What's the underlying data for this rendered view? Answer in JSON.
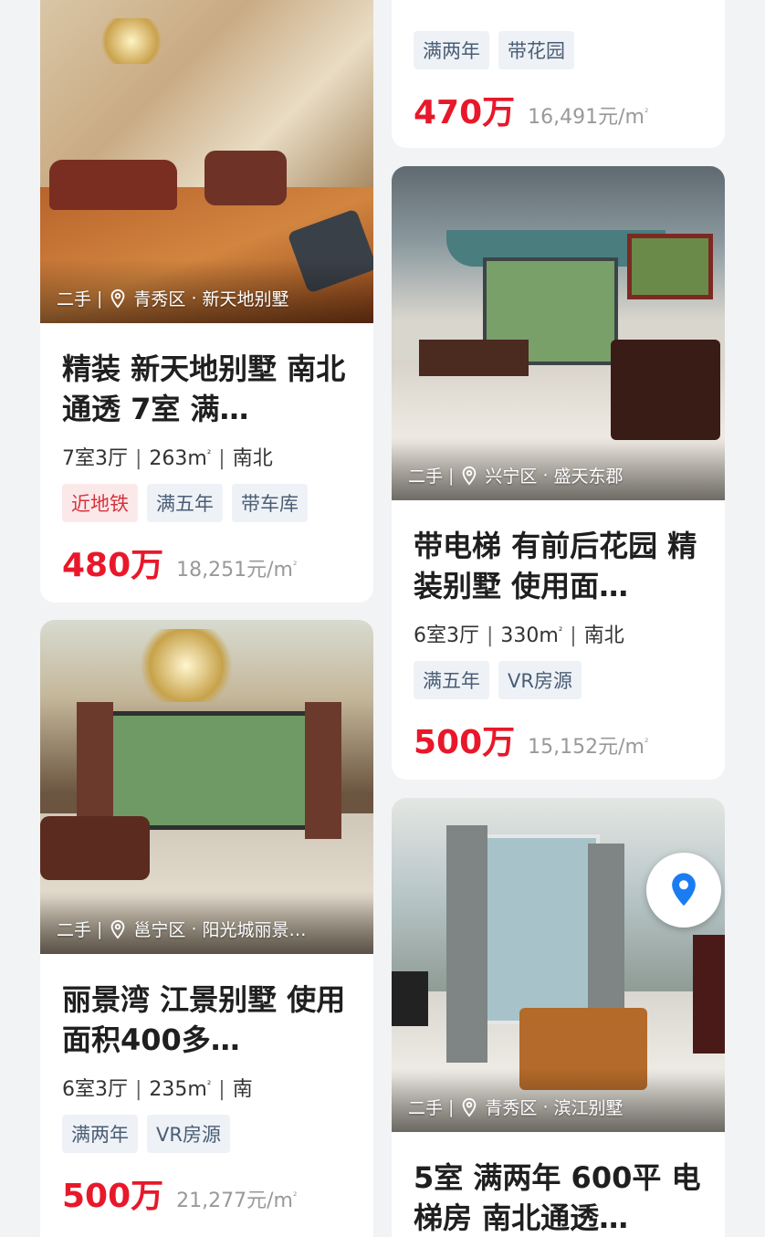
{
  "listings": [
    {
      "photo_label": "二手",
      "district": "青秀区",
      "community": "新天地别墅",
      "title": "精装  新天地别墅  南北通透  7室  满…",
      "layout": "7室3厅",
      "area": "263m",
      "area_sup": "²",
      "orientation": "南北",
      "tags": [
        "近地铁",
        "满五年",
        "带车库"
      ],
      "price": "480万",
      "unit_price": "18,251元/m",
      "unit_sup": "²"
    },
    {
      "tags": [
        "满两年",
        "带花园"
      ],
      "price": "470万",
      "unit_price": "16,491元/m",
      "unit_sup": "²"
    },
    {
      "photo_label": "二手",
      "district": "兴宁区",
      "community": "盛天东郡",
      "title": "带电梯  有前后花园  精装别墅  使用面…",
      "layout": "6室3厅",
      "area": "330m",
      "area_sup": "²",
      "orientation": "南北",
      "tags": [
        "满五年",
        "VR房源"
      ],
      "price": "500万",
      "unit_price": "15,152元/m",
      "unit_sup": "²"
    },
    {
      "photo_label": "二手",
      "district": "邕宁区",
      "community": "阳光城丽景…",
      "title": "丽景湾  江景别墅  使用面积400多…",
      "layout": "6室3厅",
      "area": "235m",
      "area_sup": "²",
      "orientation": "南",
      "tags": [
        "满两年",
        "VR房源"
      ],
      "price": "500万",
      "unit_price": "21,277元/m",
      "unit_sup": "²"
    },
    {
      "photo_label": "二手",
      "district": "青秀区",
      "community": "滨江别墅",
      "title": "5室  满两年  600平  电梯房  南北通透…"
    }
  ],
  "separators": {
    "pipe": "|",
    "dot": "·"
  },
  "icons": {
    "location": "location-pin-icon",
    "map": "map-pin-icon"
  },
  "colors": {
    "price": "#e8182a",
    "metro_tag": "#d6333d",
    "tag_text": "#4a5d74",
    "map_pin": "#1b7cf2"
  }
}
